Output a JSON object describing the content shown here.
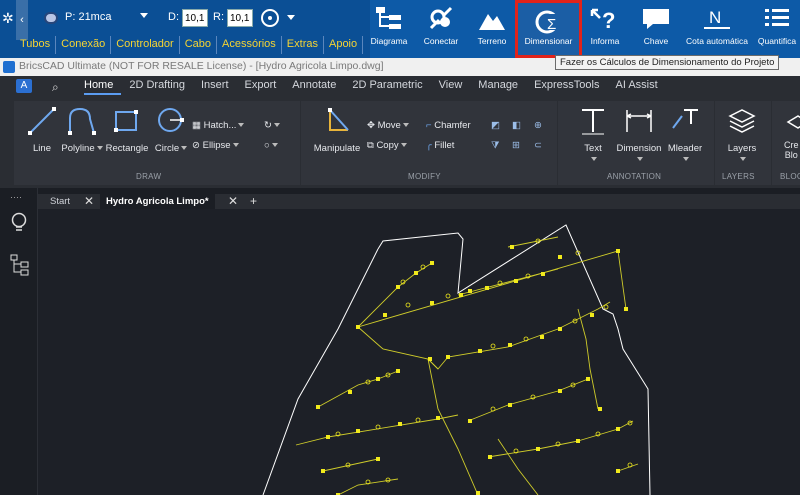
{
  "plugin": {
    "pressure": "P: 21mca",
    "d_label": "D:",
    "d_value": "10,1",
    "r_label": "R:",
    "r_value": "10,1",
    "menu": [
      "Tubos",
      "Conexão",
      "Controlador",
      "Cabo",
      "Acessórios",
      "Extras",
      "Apoio"
    ],
    "tools": [
      {
        "label": "Diagrama"
      },
      {
        "label": "Conectar"
      },
      {
        "label": "Terreno"
      },
      {
        "label": "Dimensionar"
      },
      {
        "label": "Informa"
      },
      {
        "label": "Chave"
      },
      {
        "label": "Cota automática"
      },
      {
        "label": "Quantifica"
      }
    ],
    "tooltip": "Fazer os Cálculos de Dimensionamento do Projeto"
  },
  "titlebar": {
    "title": "BricsCAD Ultimate (NOT FOR RESALE License) - [Hydro Agricola Limpo.dwg]"
  },
  "ribbon": {
    "tabs": [
      "Home",
      "2D Drafting",
      "Insert",
      "Export",
      "Annotate",
      "2D Parametric",
      "View",
      "Manage",
      "ExpressTools",
      "AI Assist"
    ],
    "draw": {
      "line": "Line",
      "polyline": "Polyline",
      "rectangle": "Rectangle",
      "circle": "Circle",
      "hatch": "Hatch...",
      "ellipse": "Ellipse",
      "group": "DRAW"
    },
    "modify": {
      "manipulate": "Manipulate",
      "move": "Move",
      "copy": "Copy",
      "chamfer": "Chamfer",
      "fillet": "Fillet",
      "group": "MODIFY"
    },
    "annotation": {
      "text": "Text",
      "dimension": "Dimension",
      "mleader": "Mleader",
      "group": "ANNOTATION"
    },
    "layers": {
      "layers": "Layers",
      "group": "LAYERS"
    },
    "blocks": {
      "create": "Cre",
      "create2": "Blo",
      "group": "BLOC"
    }
  },
  "doctabs": {
    "start": "Start",
    "active": "Hydro Agricola Limpo*",
    "add": "+"
  },
  "colors": {
    "plugin_bg": "#0d5aa7",
    "menu_text": "#f5d433",
    "highlight": "#e2231a",
    "ribbon_bg": "#2a2d33",
    "canvas_bg": "#1d2027",
    "pipe_yellow": "#e6e12a"
  }
}
